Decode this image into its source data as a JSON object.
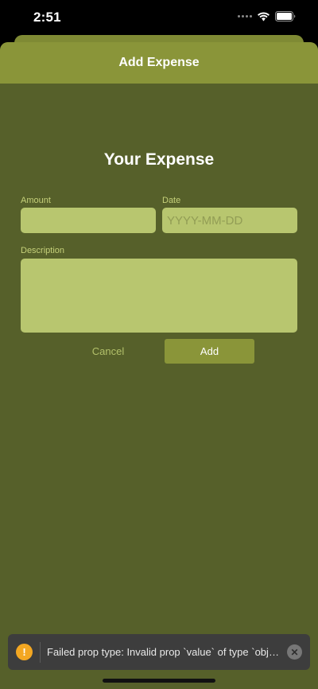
{
  "status_bar": {
    "time": "2:51"
  },
  "header": {
    "title": "Add Expense"
  },
  "form": {
    "title": "Your Expense",
    "amount": {
      "label": "Amount",
      "value": "",
      "placeholder": ""
    },
    "date": {
      "label": "Date",
      "value": "",
      "placeholder": "YYYY-MM-DD"
    },
    "description": {
      "label": "Description",
      "value": "",
      "placeholder": ""
    },
    "cancel_label": "Cancel",
    "add_label": "Add"
  },
  "toast": {
    "icon": "warning-icon",
    "message": "Failed prop type: Invalid prop `value` of type `object` supplied",
    "close_icon": "close-icon"
  },
  "colors": {
    "background": "#56602a",
    "header": "#8a9539",
    "input": "#b8c66f",
    "label": "#c5d07a",
    "warning": "#f3a722"
  }
}
